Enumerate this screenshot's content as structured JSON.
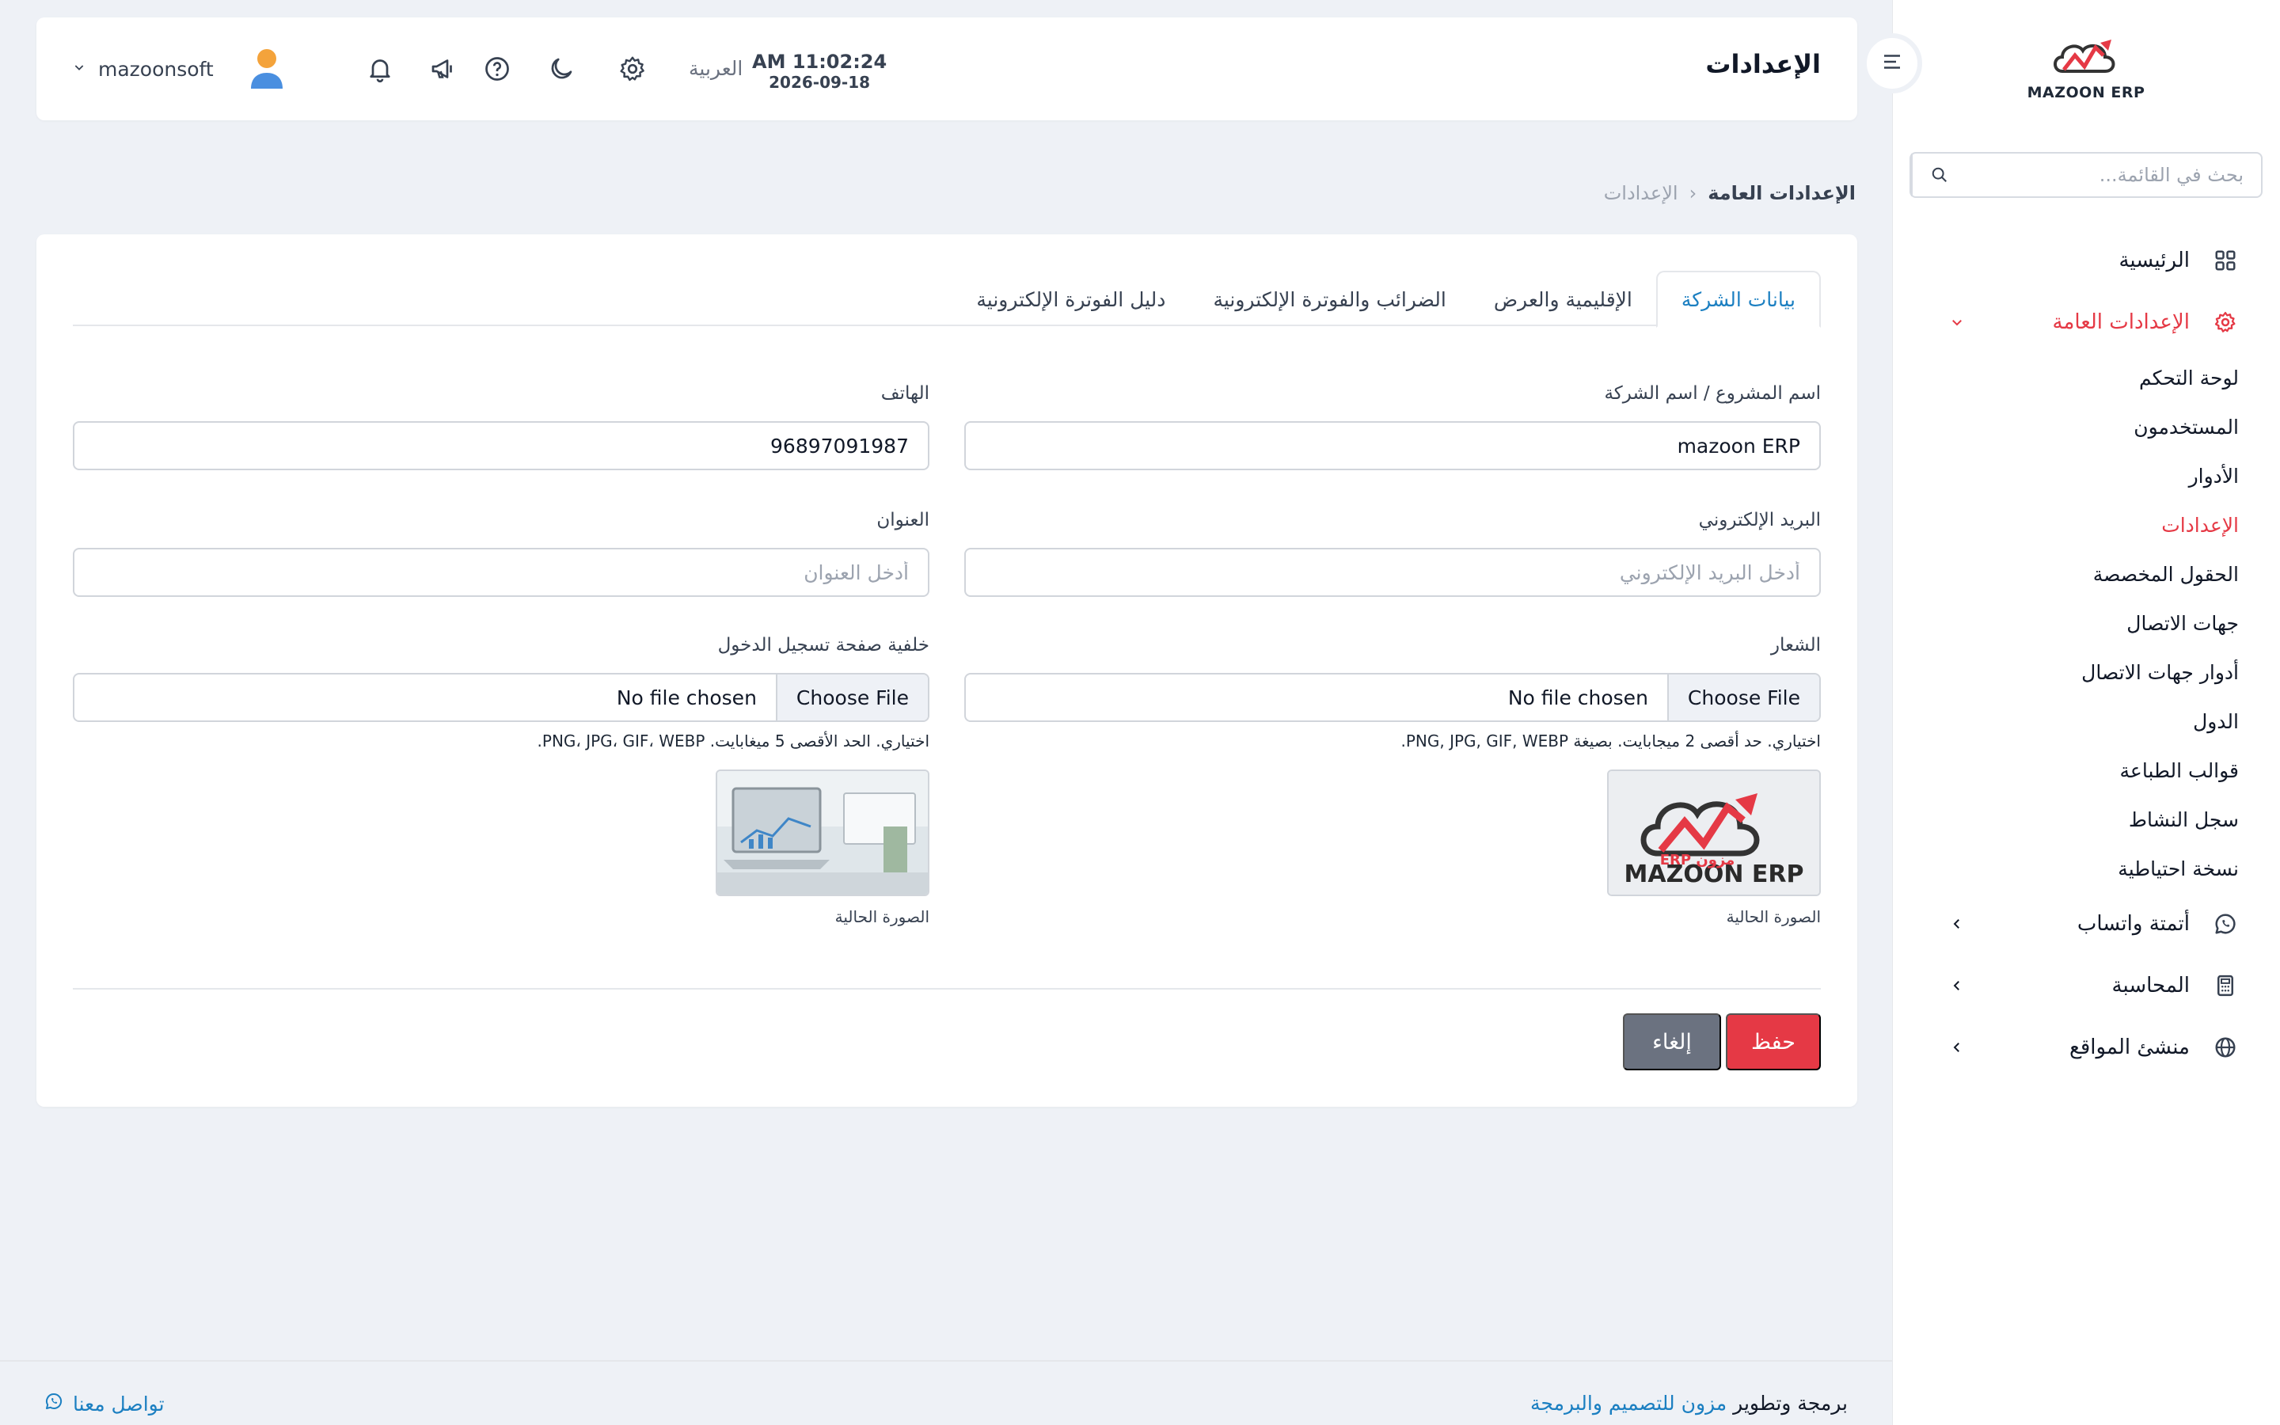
{
  "brand": {
    "name": "MAZOON ERP",
    "tag": "مزون ERP"
  },
  "sidebar": {
    "search_placeholder": "بحث في القائمة...",
    "items": [
      {
        "label": "الرئيسية",
        "icon": "grid-icon"
      },
      {
        "label": "الإعدادات العامة",
        "icon": "gear-icon",
        "expanded": true
      },
      {
        "label": "أتمتة واتساب",
        "icon": "whatsapp-icon"
      },
      {
        "label": "المحاسبة",
        "icon": "calculator-icon"
      },
      {
        "label": "منشئ المواقع",
        "icon": "globe-icon"
      }
    ],
    "sub_items": [
      {
        "label": "لوحة التحكم"
      },
      {
        "label": "المستخدمون"
      },
      {
        "label": "الأدوار"
      },
      {
        "label": "الإعدادات",
        "active": true
      },
      {
        "label": "الحقول المخصصة"
      },
      {
        "label": "جهات الاتصال"
      },
      {
        "label": "أدوار جهات الاتصال"
      },
      {
        "label": "الدول"
      },
      {
        "label": "قوالب الطباعة"
      },
      {
        "label": "سجل النشاط"
      },
      {
        "label": "نسخة احتياطية"
      }
    ]
  },
  "header": {
    "title": "الإعدادات",
    "time": "AM 11:02:24",
    "date": "2026-09-18",
    "language": "العربية",
    "user_name": "mazoonsoft"
  },
  "breadcrumb": {
    "current": "الإعدادات العامة",
    "separator": "‹",
    "link": "الإعدادات"
  },
  "tabs": [
    {
      "label": "بيانات الشركة",
      "active": true
    },
    {
      "label": "الإقليمية والعرض"
    },
    {
      "label": "الضرائب والفوترة الإلكترونية"
    },
    {
      "label": "دليل الفوترة الإلكترونية"
    }
  ],
  "form": {
    "company_name": {
      "label": "اسم المشروع / اسم الشركة",
      "value": "mazoon ERP"
    },
    "phone": {
      "label": "الهاتف",
      "value": "96897091987"
    },
    "email": {
      "label": "البريد الإلكتروني",
      "placeholder": "أدخل البريد الإلكتروني"
    },
    "address": {
      "label": "العنوان",
      "placeholder": "أدخل العنوان"
    },
    "logo": {
      "label": "الشعار",
      "button": "Choose File",
      "file": "No file chosen",
      "help": "اختياري. حد أقصى 2 ميجابايت. بصيغة PNG, JPG, GIF, WEBP.",
      "preview_caption": "الصورة الحالية"
    },
    "login_bg": {
      "label": "خلفية صفحة تسجيل الدخول",
      "button": "Choose File",
      "file": "No file chosen",
      "help": "اختياري. الحد الأقصى 5 ميغابايت. PNG، JPG، GIF، WEBP.",
      "preview_caption": "الصورة الحالية"
    },
    "save_label": "حفظ",
    "cancel_label": "إلغاء"
  },
  "footer": {
    "credit_prefix": "برمجة وتطوير",
    "credit_link": "مزون للتصميم والبرمجة",
    "contact": "تواصل معنا"
  },
  "colors": {
    "accent": "#e53945",
    "link": "#1b7fc1",
    "background": "#eef1f6"
  }
}
